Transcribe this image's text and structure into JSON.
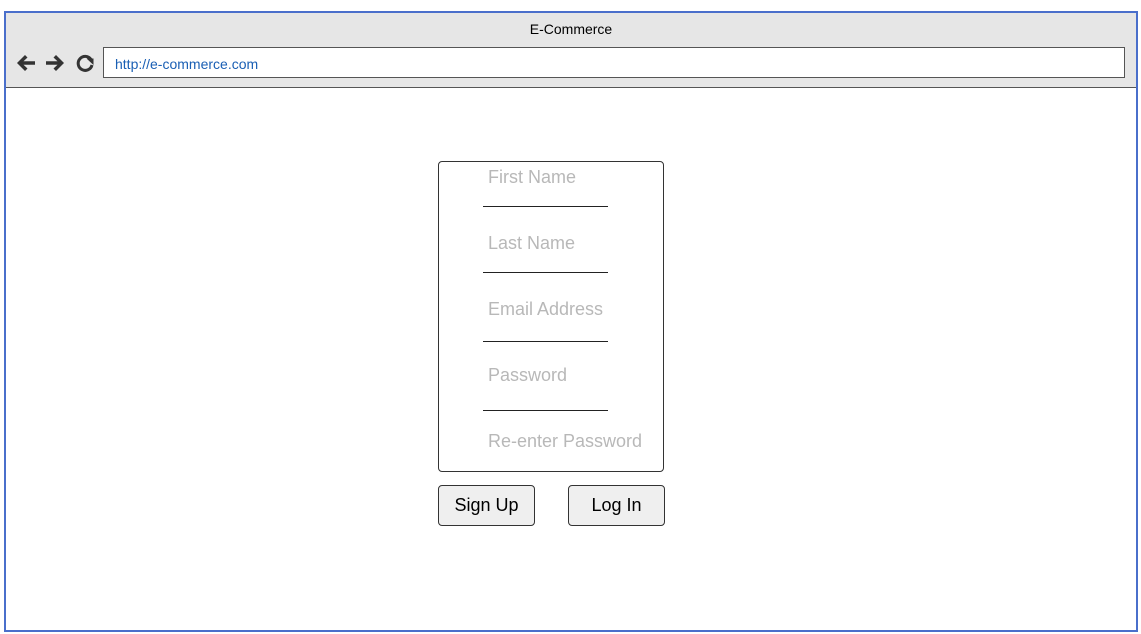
{
  "browser": {
    "title": "E-Commerce",
    "url": "http://e-commerce.com",
    "icons": [
      "back-arrow-icon",
      "forward-arrow-icon",
      "refresh-icon"
    ]
  },
  "form": {
    "fields": [
      {
        "label": "First Name"
      },
      {
        "label": "Last Name"
      },
      {
        "label": "Email Address"
      },
      {
        "label": "Password"
      },
      {
        "label": "Re-enter Password"
      }
    ]
  },
  "buttons": {
    "sign_up": "Sign Up",
    "log_in": "Log In"
  },
  "colors": {
    "window_border": "#4a6fcb",
    "chrome_bg": "#e6e6e6",
    "url_text": "#1a5fb4",
    "placeholder_text": "#b8b8b8",
    "button_bg": "#efefef"
  }
}
